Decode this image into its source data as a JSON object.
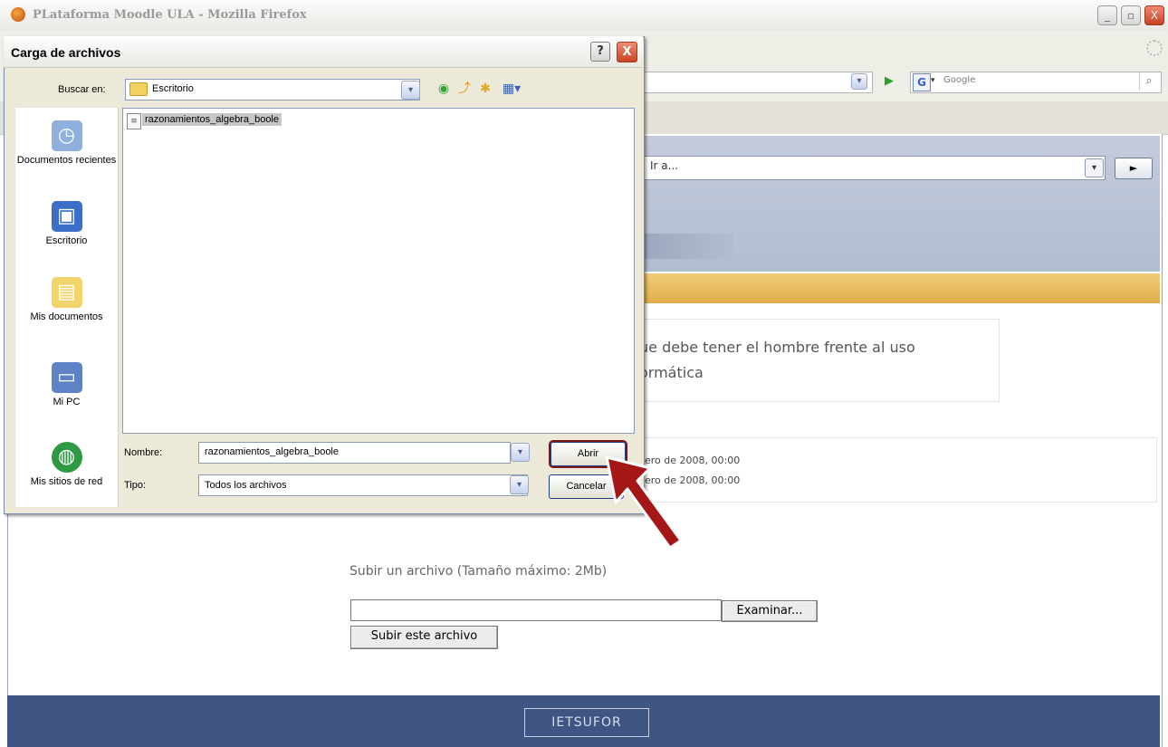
{
  "firefox": {
    "title": "PLataforma Moodle ULA - Mozilla Firefox",
    "window_controls": {
      "minimize": "_",
      "restore": "▫",
      "close": "X"
    },
    "search_placeholder": "Google",
    "search_engine_icon": "google-g-icon"
  },
  "moodle": {
    "goto_text": "Ir a...",
    "goto_button": "►",
    "description_lines": [
      "ue debe tener el hombre frente al uso",
      "ormática"
    ],
    "dates": [
      "ero de 2008, 00:00",
      "ero de 2008, 00:00"
    ],
    "upload_label": "Subir un archivo (Tamaño máximo: 2Mb)",
    "browse_button": "Examinar...",
    "submit_button": "Subir este archivo",
    "footer_button": "IETSUFOR"
  },
  "dialog": {
    "title": "Carga de archivos",
    "help_button": "?",
    "close_button": "X",
    "look_in_label": "Buscar en:",
    "look_in_value": "Escritorio",
    "places": [
      {
        "label": "Documentos recientes",
        "icon": "recent-documents-icon"
      },
      {
        "label": "Escritorio",
        "icon": "desktop-icon"
      },
      {
        "label": "Mis documentos",
        "icon": "my-documents-icon"
      },
      {
        "label": "Mi PC",
        "icon": "my-computer-icon"
      },
      {
        "label": "Mis sitios de red",
        "icon": "network-places-icon"
      }
    ],
    "files": [
      {
        "name": "razonamientos_algebra_boole",
        "selected": true
      }
    ],
    "name_label": "Nombre:",
    "name_value": "razonamientos_algebra_boole",
    "type_label": "Tipo:",
    "type_value": "Todos los archivos",
    "open_button": "Abrir",
    "cancel_button": "Cancelar"
  },
  "colors": {
    "dialog_bg": "#ece9d8",
    "moodle_header": "#b8c1d4",
    "moodle_gold": "#e7b555",
    "moodle_footer": "#3f5684",
    "arrow": "#a51717"
  }
}
